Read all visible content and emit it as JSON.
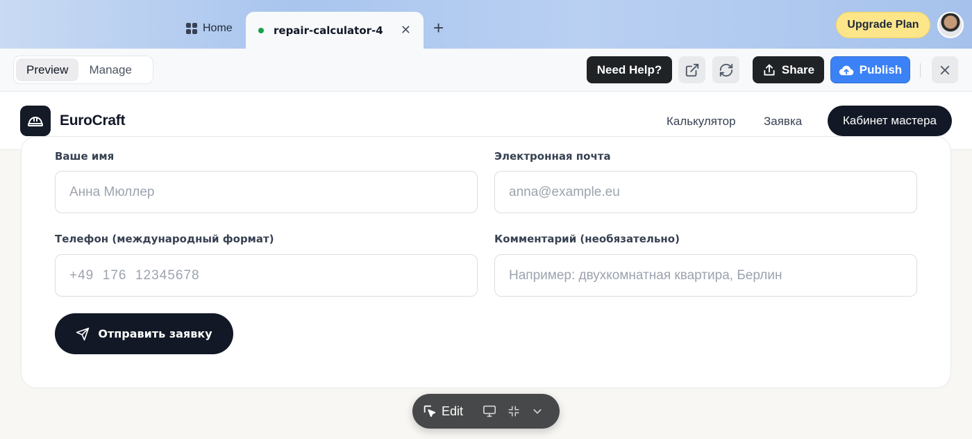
{
  "browser": {
    "tabs": [
      {
        "label": "Home"
      },
      {
        "label": "repair-calculator-4"
      }
    ],
    "upgrade_label": "Upgrade Plan"
  },
  "toolbar": {
    "segments": [
      "Preview",
      "Manage"
    ],
    "help_label": "Need Help?",
    "share_label": "Share",
    "publish_label": "Publish"
  },
  "site": {
    "brand": "EuroCraft",
    "nav": [
      "Калькулятор",
      "Заявка"
    ],
    "cabinet_label": "Кабинет мастера"
  },
  "form": {
    "name_label": "Ваше имя",
    "name_placeholder": "Анна Мюллер",
    "email_label": "Электронная почта",
    "email_placeholder": "anna@example.eu",
    "phone_label": "Телефон (международный формат)",
    "phone_placeholder": "+49  176  12345678",
    "comment_label": "Комментарий (необязательно)",
    "comment_placeholder": "Например: двухкомнатная квартира, Берлин",
    "submit_label": "Отправить заявку"
  },
  "floatbar": {
    "edit_label": "Edit"
  },
  "colors": {
    "accent_blue": "#3b82f6",
    "dark": "#121826",
    "upgrade_yellow": "#fde68a",
    "live_dot": "#16a34a"
  }
}
